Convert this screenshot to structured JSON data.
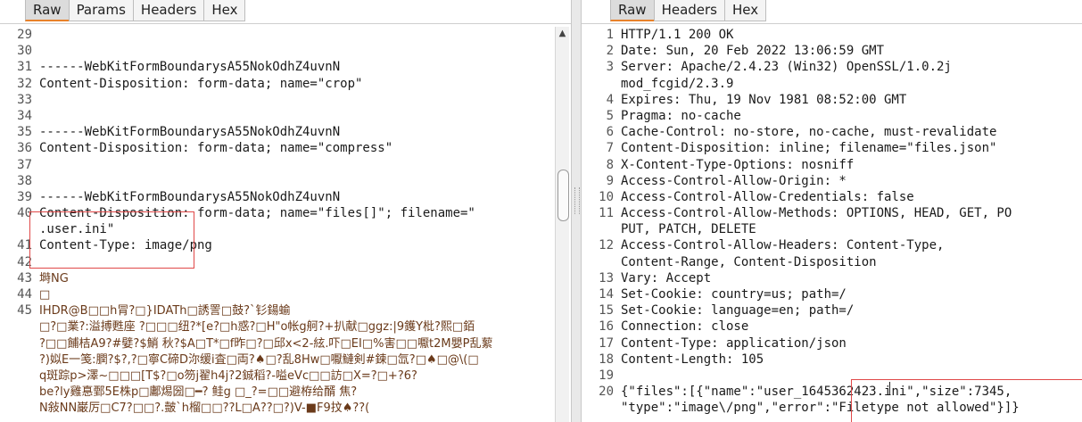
{
  "left_tabs": [
    "Raw",
    "Params",
    "Headers",
    "Hex"
  ],
  "right_tabs": [
    "Raw",
    "Headers",
    "Hex"
  ],
  "active_tab": "Raw",
  "accent_color": "#e8812a",
  "highlight_color": "#e04848",
  "scroll_up_icon": "triangle-up-icon",
  "request_lines": [
    {
      "n": "29",
      "text": ""
    },
    {
      "n": "30",
      "text": ""
    },
    {
      "n": "31",
      "text": "------WebKitFormBoundarysA55NokOdhZ4uvnN"
    },
    {
      "n": "32",
      "text": "Content-Disposition: form-data; name=\"crop\""
    },
    {
      "n": "33",
      "text": ""
    },
    {
      "n": "34",
      "text": ""
    },
    {
      "n": "35",
      "text": "------WebKitFormBoundarysA55NokOdhZ4uvnN"
    },
    {
      "n": "36",
      "text": "Content-Disposition: form-data; name=\"compress\""
    },
    {
      "n": "37",
      "text": ""
    },
    {
      "n": "38",
      "text": ""
    },
    {
      "n": "39",
      "text": "------WebKitFormBoundarysA55NokOdhZ4uvnN"
    },
    {
      "n": "40",
      "text": "Content-Disposition: form-data; name=\"files[]\"; filename=\""
    },
    {
      "n": "",
      "text": ".user.ini\""
    },
    {
      "n": "41",
      "text": "Content-Type: image/png"
    },
    {
      "n": "42",
      "text": ""
    },
    {
      "n": "43",
      "text": "塒NG",
      "garbled": true
    },
    {
      "n": "44",
      "text": "□",
      "garbled": true
    },
    {
      "n": "45",
      "text": "IHDR@B□□h冐?□}IDATh□誘詈□鼓?`钐鍚蝓",
      "garbled": true
    },
    {
      "n": "",
      "text": "□?□業?:溢搏甦座 ?□□□纽?*[e?□h惑?□H\"o帐g舸?+扒献□ggz:|9鑊Y枇?熙□銆",
      "garbled": true
    },
    {
      "n": "",
      "text": "?□□餔桔A9?#嬖?$鮹 秋?$A□T*□f昨□?□邱x<2-絃.吓□EI□%害□□嚈t2M嬰P乱蕠",
      "garbled": true
    },
    {
      "n": "",
      "text": "?)姒E一笺:膶?$?,?□寧C碲D沵缓i査□両?♠□?乱8Hw□嚈鰱剣#鍊□氙?□♠□@\\(□",
      "garbled": true
    },
    {
      "n": "",
      "text": "q斑踪p>澤~□□□[T$?□o笏j翟h4j?2鋮稻?-嗌eVc□□訪□X=?□+?6?",
      "garbled": true
    },
    {
      "n": "",
      "text": "be?ly雞惪鄄5E株p□鄘焬圀□━? 鲑g □_?=□□避栫给醑 焦?",
      "garbled": true
    },
    {
      "n": "",
      "text": "N敍NN巌厉□C7?□□?.皼`h榴□□??L□A??□?)V-■F9抆♠??(",
      "garbled": true
    }
  ],
  "response_lines": [
    {
      "n": "1",
      "text": "HTTP/1.1 200 OK"
    },
    {
      "n": "2",
      "text": "Date: Sun, 20 Feb 2022 13:06:59 GMT"
    },
    {
      "n": "3",
      "text": "Server: Apache/2.4.23 (Win32) OpenSSL/1.0.2j"
    },
    {
      "n": "",
      "text": "mod_fcgid/2.3.9"
    },
    {
      "n": "4",
      "text": "Expires: Thu, 19 Nov 1981 08:52:00 GMT"
    },
    {
      "n": "5",
      "text": "Pragma: no-cache"
    },
    {
      "n": "6",
      "text": "Cache-Control: no-store, no-cache, must-revalidate"
    },
    {
      "n": "7",
      "text": "Content-Disposition: inline; filename=\"files.json\""
    },
    {
      "n": "8",
      "text": "X-Content-Type-Options: nosniff"
    },
    {
      "n": "9",
      "text": "Access-Control-Allow-Origin: *"
    },
    {
      "n": "10",
      "text": "Access-Control-Allow-Credentials: false"
    },
    {
      "n": "11",
      "text": "Access-Control-Allow-Methods: OPTIONS, HEAD, GET, PO"
    },
    {
      "n": "",
      "text": "PUT, PATCH, DELETE"
    },
    {
      "n": "12",
      "text": "Access-Control-Allow-Headers: Content-Type,"
    },
    {
      "n": "",
      "text": "Content-Range, Content-Disposition"
    },
    {
      "n": "13",
      "text": "Vary: Accept"
    },
    {
      "n": "14",
      "text": "Set-Cookie: country=us; path=/"
    },
    {
      "n": "15",
      "text": "Set-Cookie: language=en; path=/"
    },
    {
      "n": "16",
      "text": "Connection: close"
    },
    {
      "n": "17",
      "text": "Content-Type: application/json"
    },
    {
      "n": "18",
      "text": "Content-Length: 105"
    },
    {
      "n": "19",
      "text": ""
    },
    {
      "n": "20",
      "text": "{\"files\":[{\"name\":\"user_1645362423.ini\",\"size\":7345,"
    },
    {
      "n": "",
      "text": "\"type\":\"image\\/png\",\"error\":\"Filetype not allowed\"}]}"
    }
  ]
}
